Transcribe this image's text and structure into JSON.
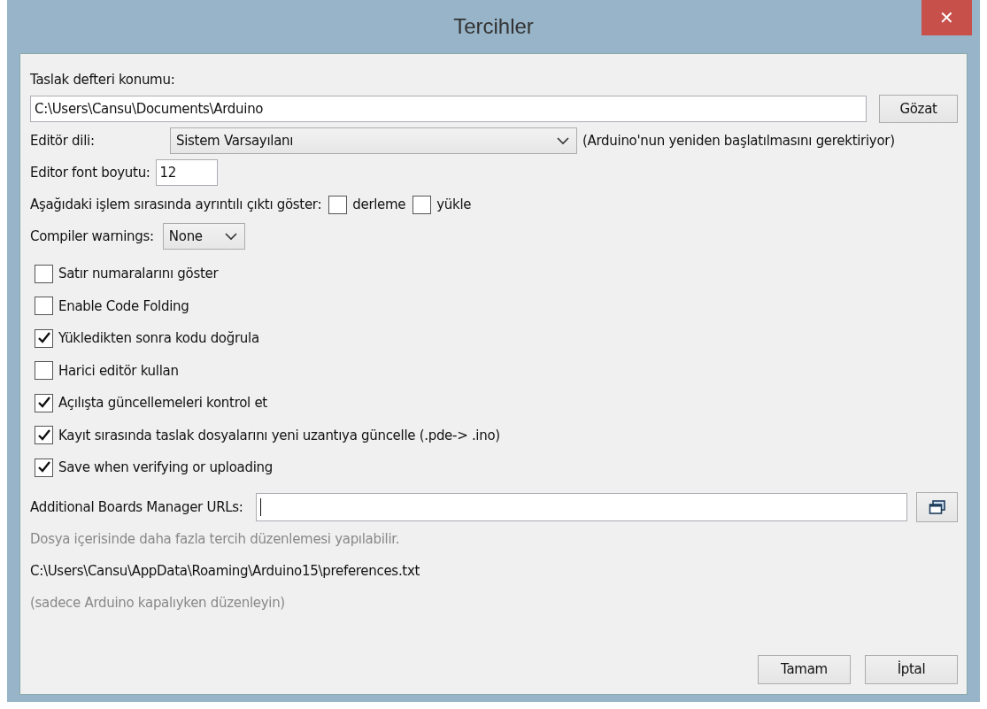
{
  "window": {
    "title": "Tercihler",
    "close": "✕"
  },
  "sketchbook": {
    "label": "Taslak defteri konumu:",
    "value": "C:\\Users\\Cansu\\Documents\\Arduino",
    "button": "Gözat"
  },
  "language": {
    "label": "Editör dili:",
    "value": "Sistem Varsayılanı",
    "note": "(Arduino'nun yeniden başlatılmasını gerektiriyor)"
  },
  "font_size": {
    "label": "Editor font boyutu:",
    "value": "12"
  },
  "verbose": {
    "label": "Aşağıdaki işlem sırasında ayrıntılı çıktı göster:",
    "options": [
      {
        "label": "derleme",
        "checked": false
      },
      {
        "label": "yükle",
        "checked": false
      }
    ]
  },
  "warnings": {
    "label": "Compiler warnings:",
    "value": "None"
  },
  "options": [
    {
      "label": "Satır numaralarını göster",
      "checked": false
    },
    {
      "label": "Enable Code Folding",
      "checked": false
    },
    {
      "label": "Yükledikten sonra kodu doğrula",
      "checked": true
    },
    {
      "label": "Harici editör kullan",
      "checked": false
    },
    {
      "label": "Açılışta güncellemeleri kontrol et",
      "checked": true
    },
    {
      "label": "Kayıt sırasında taslak dosyalarını yeni uzantıya güncelle (.pde-> .ino)",
      "checked": true
    },
    {
      "label": "Save when verifying or uploading",
      "checked": true
    }
  ],
  "boards_urls": {
    "label": "Additional Boards Manager URLs:"
  },
  "info": "Dosya içerisinde daha fazla tercih düzenlemesi yapılabilir.",
  "prefs_path": "C:\\Users\\Cansu\\AppData\\Roaming\\Arduino15\\preferences.txt",
  "note": "(sadece Arduino kapalıyken düzenleyin)",
  "buttons": [
    "Tamam",
    "İptal"
  ]
}
